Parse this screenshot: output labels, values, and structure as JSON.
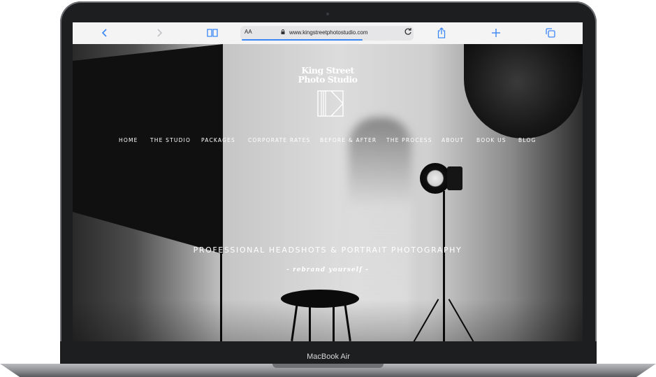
{
  "device": {
    "label": "MacBook Air"
  },
  "browser": {
    "text_size_label": "AA",
    "url": "www.kingstreetphotostudio.com",
    "icons": {
      "back": "chevron-left-icon",
      "forward": "chevron-right-icon",
      "bookmarks": "book-icon",
      "lock": "lock-icon",
      "reload": "reload-icon",
      "share": "share-icon",
      "new_tab": "plus-icon",
      "tabs": "tabs-icon"
    },
    "accent_color": "#3a86f5"
  },
  "site": {
    "brand_line1": "King Street",
    "brand_line2": "Photo Studio",
    "nav": [
      {
        "label": "HOME"
      },
      {
        "label": "THE STUDIO"
      },
      {
        "label": "PACKAGES"
      },
      {
        "label": "CORPORATE RATES"
      },
      {
        "label": "BEFORE & AFTER"
      },
      {
        "label": "THE PROCESS"
      },
      {
        "label": "ABOUT"
      },
      {
        "label": "BOOK US"
      },
      {
        "label": "BLOG"
      }
    ],
    "headline": "PROFESSIONAL HEADSHOTS & PORTRAIT PHOTOGRAPHY",
    "tagline": "- rebrand yourself -"
  }
}
